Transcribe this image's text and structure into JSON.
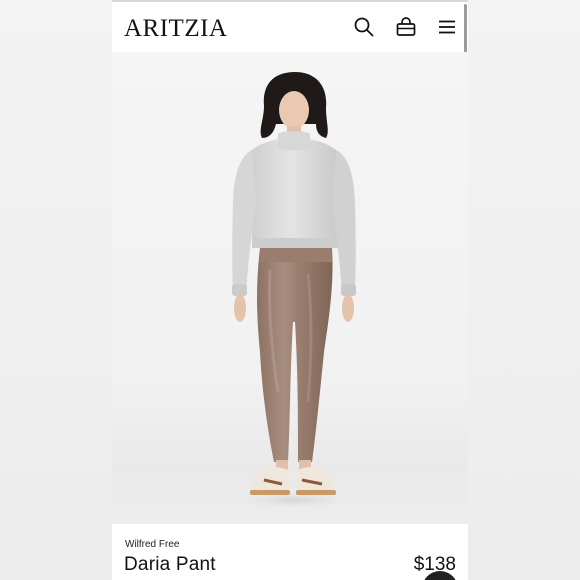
{
  "header": {
    "logo": "ARITZIA",
    "icons": [
      "search-icon",
      "shopping-bag-icon",
      "menu-icon"
    ]
  },
  "product": {
    "brand": "Wilfred Free",
    "name": "Daria Pant",
    "price": "$138"
  },
  "colors": {
    "sweater": "#dcdcdc",
    "pants": "#9b7f70",
    "background": "#f2f2f2"
  }
}
